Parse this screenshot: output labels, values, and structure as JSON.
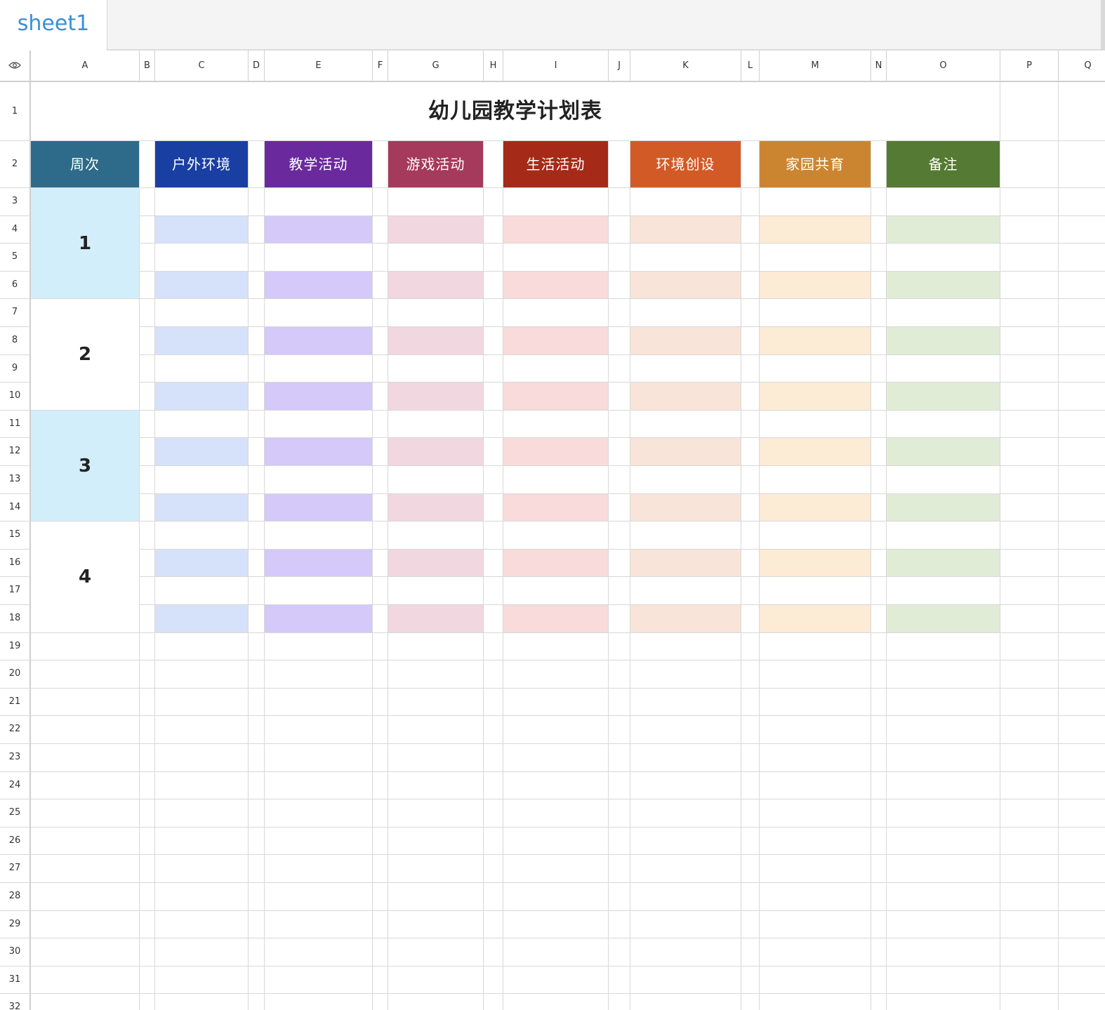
{
  "tabs": [
    {
      "label": "sheet1",
      "active": true
    }
  ],
  "columns": [
    "A",
    "B",
    "C",
    "D",
    "E",
    "F",
    "G",
    "H",
    "I",
    "J",
    "K",
    "L",
    "M",
    "N",
    "O",
    "P",
    "Q"
  ],
  "row_count": 32,
  "title": "幼儿园教学计划表",
  "headers": [
    {
      "label": "周次",
      "color": "#2e6b8a"
    },
    {
      "label": "户外环境",
      "color": "#1a3fa3"
    },
    {
      "label": "教学活动",
      "color": "#6a2a9e"
    },
    {
      "label": "游戏活动",
      "color": "#a53a5c"
    },
    {
      "label": "生活活动",
      "color": "#a52a18"
    },
    {
      "label": "环境创设",
      "color": "#d25a27"
    },
    {
      "label": "家园共育",
      "color": "#cb8530"
    },
    {
      "label": "备注",
      "color": "#557a33"
    }
  ],
  "weeks": [
    {
      "label": "1",
      "color": "#d3eefb"
    },
    {
      "label": "2",
      "color": "#ffffff"
    },
    {
      "label": "3",
      "color": "#d3eefb"
    },
    {
      "label": "4",
      "color": "#ffffff"
    }
  ],
  "stripe_colors": [
    "#d6e2fa",
    "#d4c9f8",
    "#f1d7e0",
    "#f8dbda",
    "#f9e4d9",
    "#fcebd5",
    "#e1ecd6"
  ],
  "icons": {
    "visibility": "eye-icon"
  }
}
